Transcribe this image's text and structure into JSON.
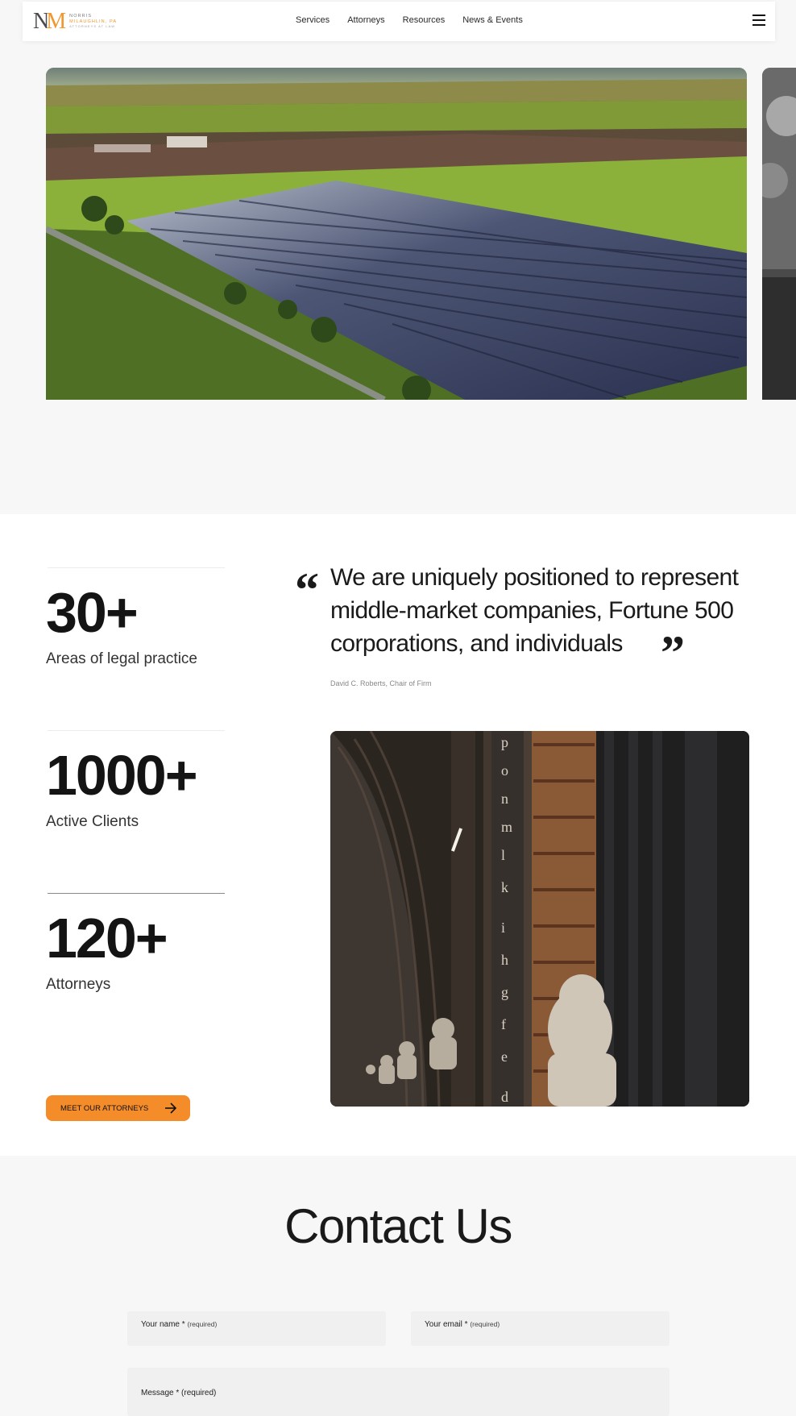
{
  "header": {
    "logo": {
      "mark_n": "N",
      "mark_m": "M",
      "line1": "NORRIS",
      "line2": "MILAUGHLIN, PA",
      "line3": "ATTORNEYS AT LAW"
    },
    "nav": [
      "Services",
      "Attorneys",
      "Resources",
      "News & Events"
    ],
    "menu_icon": "hamburger-icon"
  },
  "stats": [
    {
      "number": "30+",
      "label": "Areas of legal practice"
    },
    {
      "number": "1000+",
      "label": "Active Clients"
    },
    {
      "number": "120+",
      "label": "Attorneys"
    }
  ],
  "quote": {
    "text": "We are uniquely positioned to represent middle-market companies, Fortune 500 corporations, and individuals",
    "attribution": "David C. Roberts, Chair of Firm"
  },
  "cta": {
    "label": "MEET OUR ATTORNEYS",
    "icon": "arrow-right-icon"
  },
  "contact": {
    "title": "Contact Us",
    "name_label": "Your name *",
    "email_label": "Your email *",
    "message_label": "Message *",
    "required": "(required)"
  },
  "colors": {
    "accent": "#f58c2a",
    "section_bg": "#ffffff",
    "page_bg": "#f7f7f7"
  }
}
